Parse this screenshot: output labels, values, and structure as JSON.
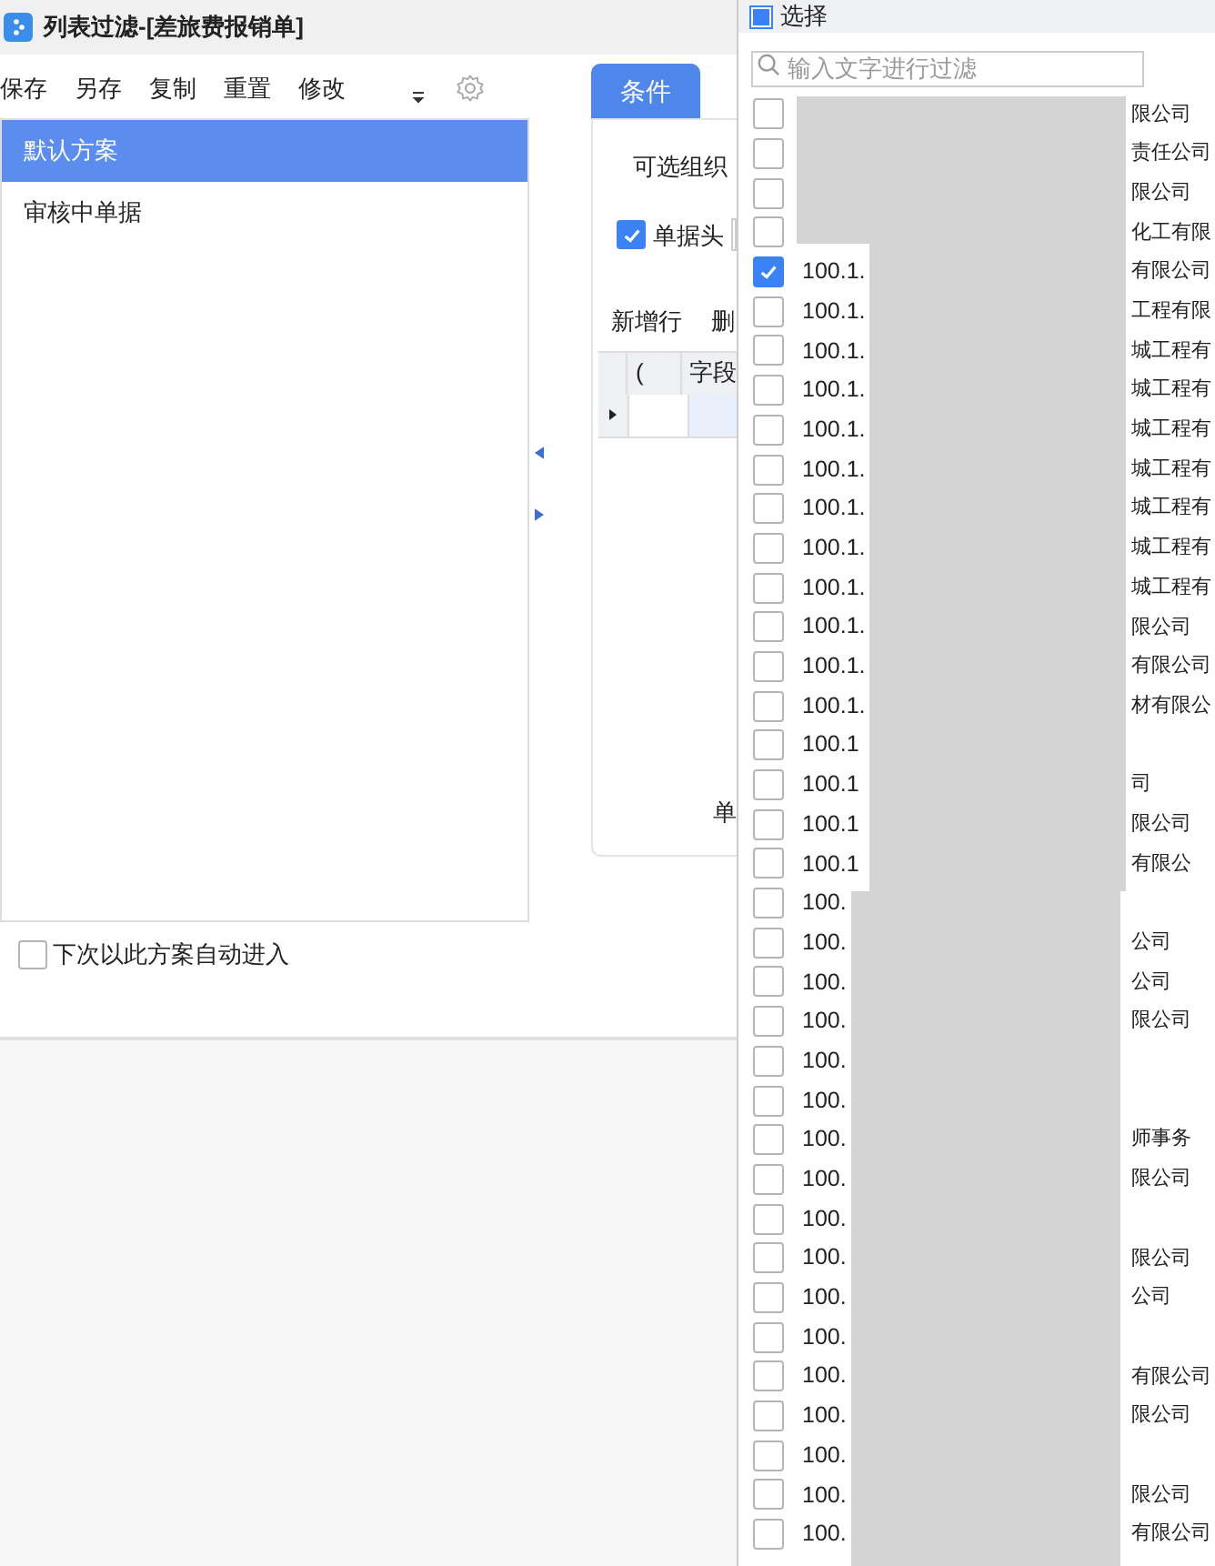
{
  "window": {
    "title": "列表过滤-[差旅费报销单]"
  },
  "toolbar": [
    "保存",
    "另存",
    "复制",
    "重置",
    "修改"
  ],
  "schemes": [
    {
      "label": "默认方案",
      "selected": true
    },
    {
      "label": "审核中单据",
      "selected": false
    }
  ],
  "auto_enter": {
    "label": "下次以此方案自动进入",
    "checked": false
  },
  "tabs": [
    {
      "label": "条件",
      "selected": true
    }
  ],
  "condition": {
    "org_label": "可选组织",
    "header_check": {
      "label": "单据头",
      "checked": true
    },
    "grid_actions": [
      "新增行",
      "删"
    ],
    "columns": [
      "(",
      "字段"
    ],
    "footer_label": "单"
  },
  "popup": {
    "title": "选择",
    "select_all": {
      "checked": false,
      "partial": true
    },
    "search": {
      "placeholder": "输入文字进行过滤"
    },
    "items": [
      {
        "name": "限公司",
        "checked": false
      },
      {
        "name": "责任公司",
        "checked": false
      },
      {
        "name": "限公司",
        "checked": false
      },
      {
        "name": "化工有限",
        "checked": false
      },
      {
        "code": "100.1.",
        "name": "有限公司",
        "checked": true
      },
      {
        "code": "100.1.",
        "name": "工程有限",
        "checked": false
      },
      {
        "code": "100.1.",
        "name": "城工程有",
        "checked": false
      },
      {
        "code": "100.1.",
        "name": "城工程有",
        "checked": false
      },
      {
        "code": "100.1.",
        "name": "城工程有",
        "checked": false
      },
      {
        "code": "100.1.",
        "name": "城工程有",
        "checked": false
      },
      {
        "code": "100.1.",
        "name": "城工程有",
        "checked": false
      },
      {
        "code": "100.1.",
        "name": "城工程有",
        "checked": false
      },
      {
        "code": "100.1.",
        "name": "城工程有",
        "checked": false
      },
      {
        "code": "100.1.",
        "name": "限公司",
        "checked": false
      },
      {
        "code": "100.1.",
        "name": "有限公司",
        "checked": false
      },
      {
        "code": "100.1.",
        "name": "材有限公",
        "checked": false
      },
      {
        "code": "100.1",
        "checked": false
      },
      {
        "code": "100.1",
        "name": "司",
        "checked": false
      },
      {
        "code": "100.1",
        "name": "限公司",
        "checked": false
      },
      {
        "code": "100.1",
        "name": "有限公",
        "checked": false
      },
      {
        "code": "100.",
        "checked": false
      },
      {
        "code": "100.",
        "name": "公司",
        "checked": false
      },
      {
        "code": "100.",
        "name": "公司",
        "checked": false
      },
      {
        "code": "100.",
        "name": "限公司",
        "checked": false
      },
      {
        "code": "100.",
        "checked": false
      },
      {
        "code": "100.",
        "checked": false
      },
      {
        "code": "100.",
        "name": "师事务",
        "checked": false
      },
      {
        "code": "100.",
        "name": "限公司",
        "checked": false
      },
      {
        "code": "100.",
        "checked": false
      },
      {
        "code": "100.",
        "name": "限公司",
        "checked": false
      },
      {
        "code": "100.",
        "name": "公司",
        "checked": false
      },
      {
        "code": "100.",
        "checked": false
      },
      {
        "code": "100.",
        "name": "有限公司",
        "checked": false
      },
      {
        "code": "100.",
        "name": "限公司",
        "checked": false
      },
      {
        "code": "100.",
        "checked": false
      },
      {
        "code": "100.",
        "name": "限公司",
        "checked": false
      },
      {
        "code": "100.",
        "name": "有限公司",
        "checked": false
      }
    ]
  }
}
